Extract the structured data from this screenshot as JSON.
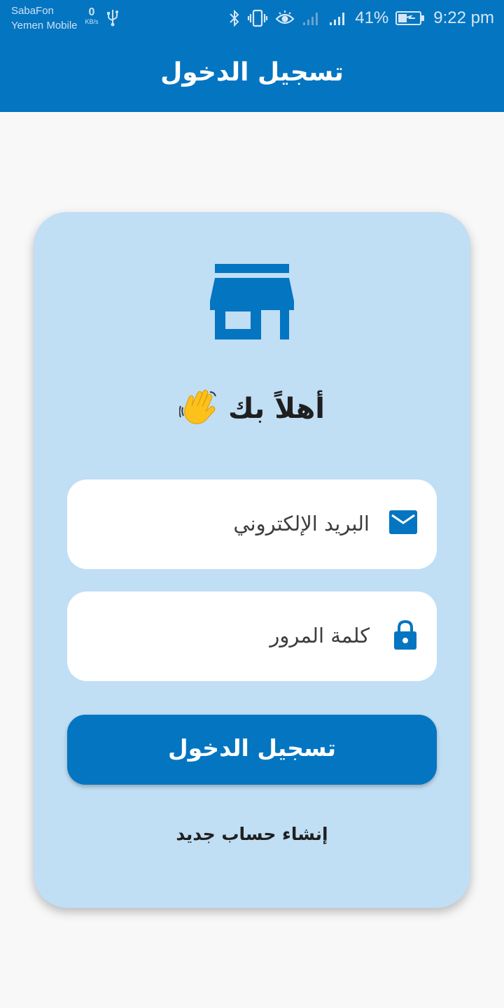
{
  "status_bar": {
    "carrier_1": "SabaFon",
    "carrier_2": "Yemen Mobile",
    "net_speed_value": "0",
    "net_speed_unit": "KB/s",
    "battery_percent": "41%",
    "time": "9:22 pm",
    "icons": [
      "usb-icon",
      "bluetooth-icon",
      "vibrate-icon",
      "eye-icon",
      "signal-1-icon",
      "signal-2-icon",
      "battery-charging-icon"
    ]
  },
  "app_bar": {
    "title": "تسجيل الدخول"
  },
  "login_card": {
    "logo_icon": "store-icon",
    "welcome_text": "أهلاً بك",
    "welcome_icon": "waving-hand-icon",
    "email_field": {
      "placeholder": "البريد الإلكتروني",
      "icon": "email-icon"
    },
    "password_field": {
      "placeholder": "كلمة المرور",
      "icon": "lock-icon"
    },
    "login_button_label": "تسجيل الدخول",
    "register_link_label": "إنشاء حساب جديد"
  },
  "colors": {
    "primary": "#0475c1",
    "card_background": "#c0def4",
    "page_background": "#f8f8f8"
  }
}
